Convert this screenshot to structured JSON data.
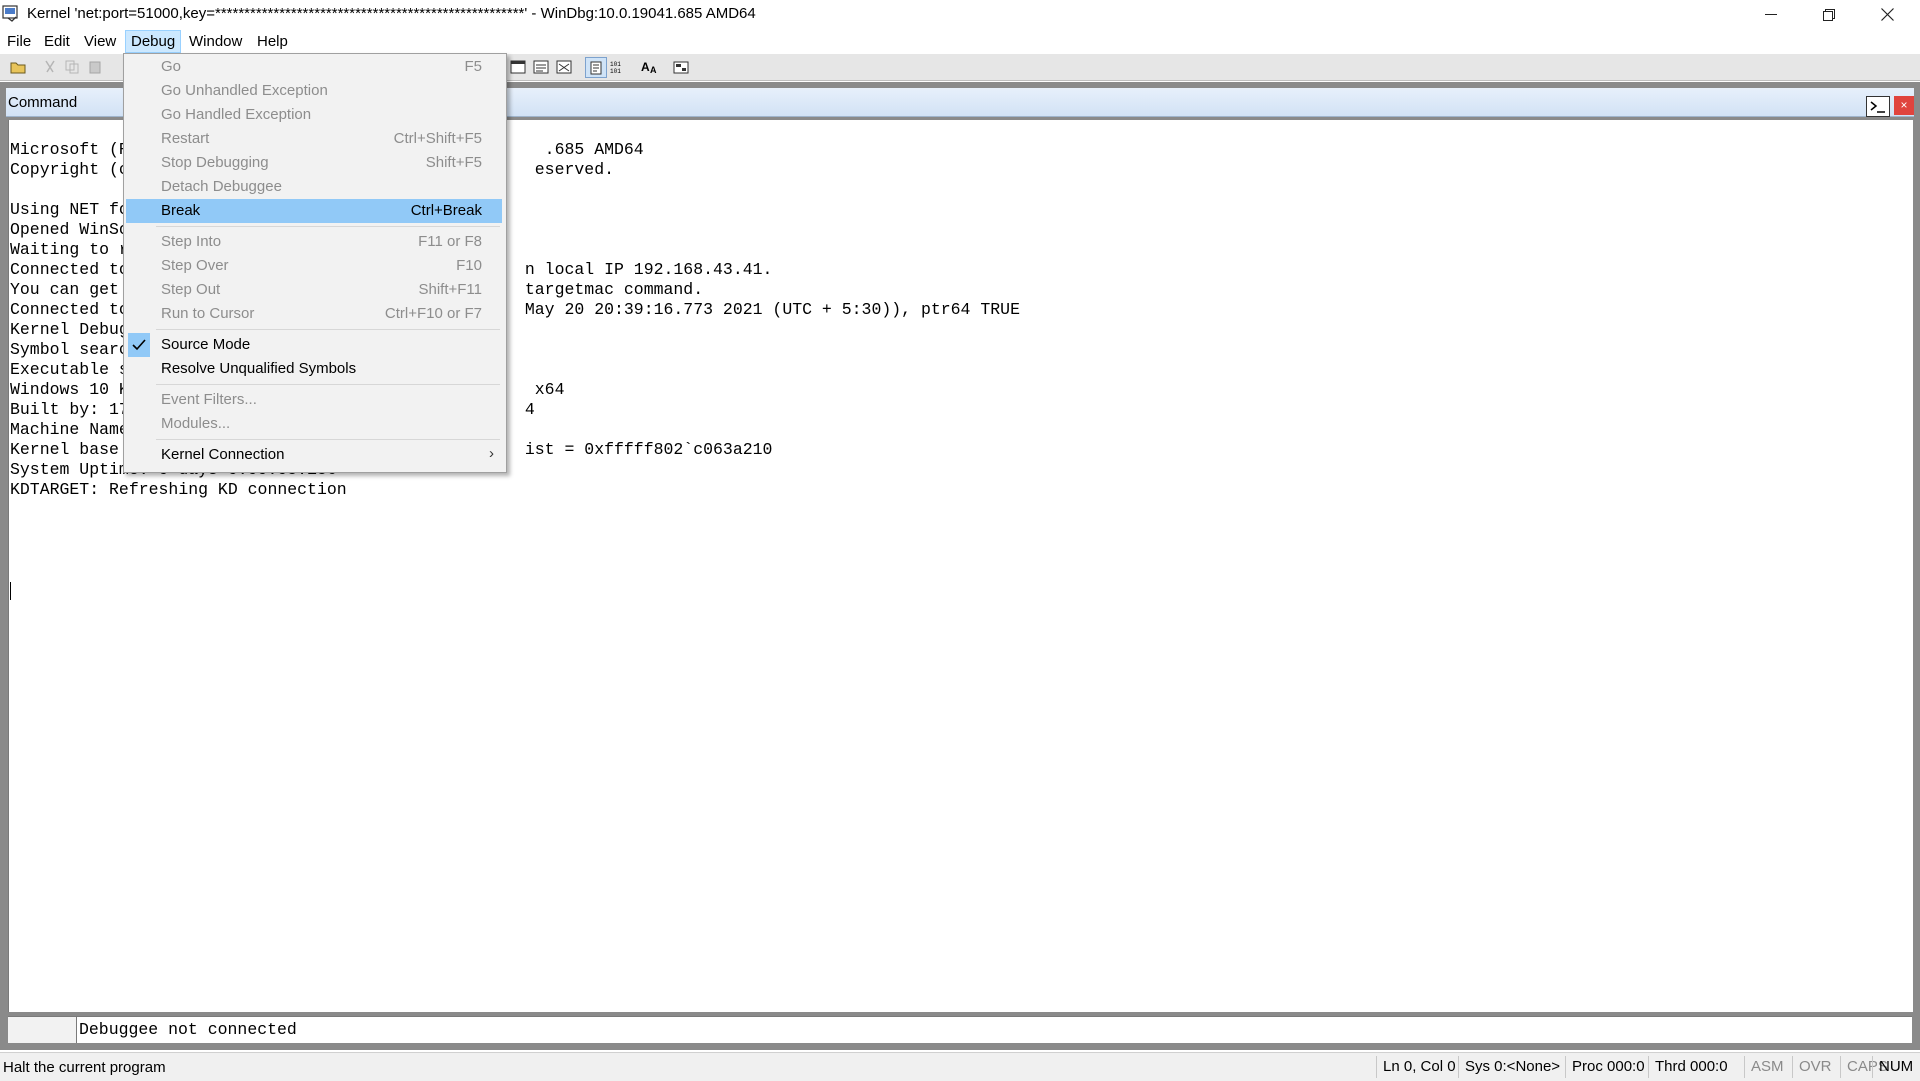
{
  "window": {
    "title": "Kernel 'net:port=51000,key=*****************************************************' - WinDbg:10.0.19041.685 AMD64"
  },
  "menubar": [
    "File",
    "Edit",
    "View",
    "Debug",
    "Window",
    "Help"
  ],
  "debug_menu": {
    "items": [
      {
        "label": "Go",
        "shortcut": "F5",
        "enabled": false
      },
      {
        "label": "Go Unhandled Exception",
        "shortcut": "",
        "enabled": false
      },
      {
        "label": "Go Handled Exception",
        "shortcut": "",
        "enabled": false
      },
      {
        "label": "Restart",
        "shortcut": "Ctrl+Shift+F5",
        "enabled": false
      },
      {
        "label": "Stop Debugging",
        "shortcut": "Shift+F5",
        "enabled": false
      },
      {
        "label": "Detach Debuggee",
        "shortcut": "",
        "enabled": false
      },
      {
        "label": "Break",
        "shortcut": "Ctrl+Break",
        "enabled": true,
        "highlighted": true
      },
      {
        "label": "Step Into",
        "shortcut": "F11 or F8",
        "enabled": false
      },
      {
        "label": "Step Over",
        "shortcut": "F10",
        "enabled": false
      },
      {
        "label": "Step Out",
        "shortcut": "Shift+F11",
        "enabled": false
      },
      {
        "label": "Run to Cursor",
        "shortcut": "Ctrl+F10 or F7",
        "enabled": false
      },
      {
        "label": "Source Mode",
        "shortcut": "",
        "enabled": true,
        "checked": true
      },
      {
        "label": "Resolve Unqualified Symbols",
        "shortcut": "",
        "enabled": true
      },
      {
        "label": "Event Filters...",
        "shortcut": "",
        "enabled": false
      },
      {
        "label": "Modules...",
        "shortcut": "",
        "enabled": false
      },
      {
        "label": "Kernel Connection",
        "shortcut": "",
        "enabled": true,
        "submenu": true
      }
    ]
  },
  "command_window": {
    "title": "Command",
    "lines": [
      "Microsoft (R                                          .685 AMD64",
      "Copyright (c                                         eserved.",
      "",
      "Using NET fo",
      "Opened WinSo",
      "Waiting to r",
      "Connected to                                        n local IP 192.168.43.41.",
      "You can get                                         targetmac command.",
      "Connected to                                        May 20 20:39:16.773 2021 (UTC + 5:30)), ptr64 TRUE",
      "Kernel Debug",
      "Symbol searc",
      "Executable s",
      "Windows 10 K                                         x64",
      "Built by: 17                                        4",
      "Machine Name",
      "Kernel base                                         ist = 0xfffff802`c063a210",
      "System Uptime: 0 days 0:00:05.156",
      "KDTARGET: Refreshing KD connection"
    ],
    "input_status": "Debuggee not connected"
  },
  "statusbar": {
    "message": "Halt the current program",
    "cells": [
      {
        "text": "Ln 0, Col 0",
        "dim": false
      },
      {
        "text": "Sys 0:<None>",
        "dim": false
      },
      {
        "text": "Proc 000:0",
        "dim": false
      },
      {
        "text": "Thrd 000:0",
        "dim": false
      },
      {
        "text": "ASM",
        "dim": true
      },
      {
        "text": "OVR",
        "dim": true
      },
      {
        "text": "CAPS",
        "dim": true
      },
      {
        "text": "NUM",
        "dim": false
      }
    ]
  },
  "icons": {
    "minimize": "minimize-icon",
    "maximize": "restore-icon",
    "close": "close-icon",
    "checkmark": "check-icon",
    "submenu_arrow": "chevron-right-icon"
  },
  "colors": {
    "menu_highlight": "#91c9f7",
    "active_menu": "#cce8ff",
    "close_button": "#e0443e"
  }
}
